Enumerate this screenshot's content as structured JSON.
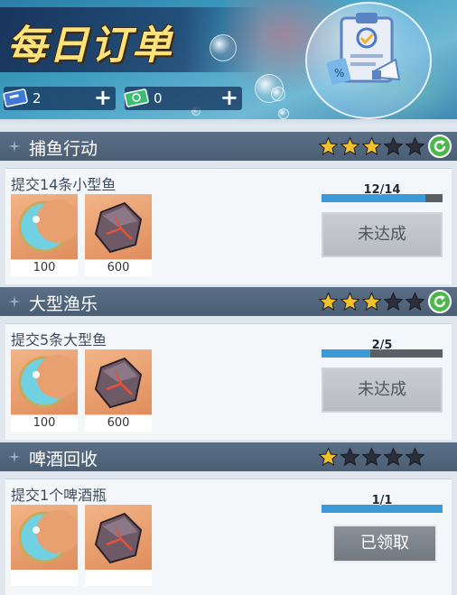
{
  "header": {
    "title": "每日订单",
    "currencies": [
      {
        "icon": "ticket-blue-icon",
        "value": "2"
      },
      {
        "icon": "ticket-green-icon",
        "value": "0"
      }
    ]
  },
  "orders": [
    {
      "name": "捕鱼行动",
      "stars_filled": 3,
      "stars_total": 5,
      "requirement": "提交14条小型鱼",
      "rewards": [
        {
          "icon": "crescent-moon-icon",
          "qty": "100"
        },
        {
          "icon": "ore-rock-icon",
          "qty": "600"
        }
      ],
      "progress_text": "12/14",
      "progress": 0.857,
      "status": "未达成"
    },
    {
      "name": "大型渔乐",
      "stars_filled": 3,
      "stars_total": 5,
      "requirement": "提交5条大型鱼",
      "rewards": [
        {
          "icon": "crescent-moon-icon",
          "qty": "100"
        },
        {
          "icon": "ore-rock-icon",
          "qty": "600"
        }
      ],
      "progress_text": "2/5",
      "progress": 0.4,
      "status": "未达成"
    },
    {
      "name": "啤酒回收",
      "stars_filled": 1,
      "stars_total": 5,
      "requirement": "提交1个啤酒瓶",
      "rewards": [
        {
          "icon": "crescent-moon-icon",
          "qty": ""
        },
        {
          "icon": "ore-rock-icon",
          "qty": ""
        }
      ],
      "progress_text": "1/1",
      "progress": 1.0,
      "status": "已领取"
    }
  ],
  "colors": {
    "star_filled": "#f3c12c",
    "star_empty": "#2a2f3a",
    "progress_fill": "#3a9bd8",
    "refresh_green": "#4cb84a"
  }
}
